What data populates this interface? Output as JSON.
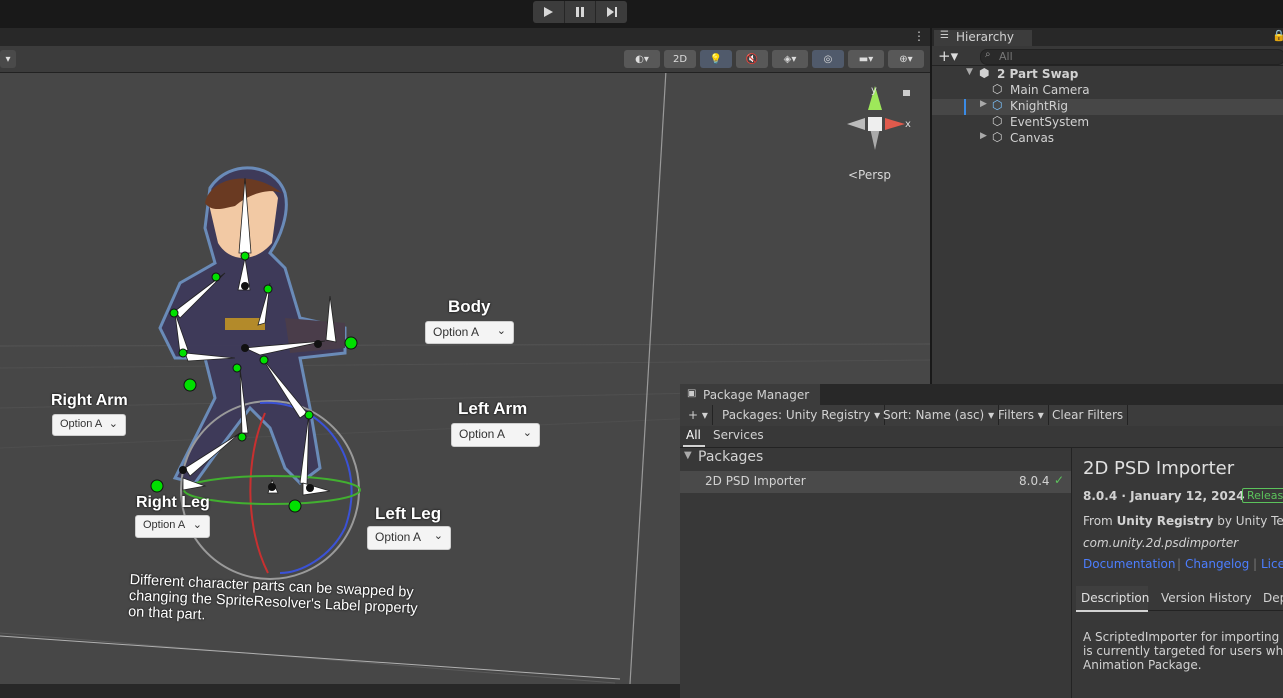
{
  "toolbar": {
    "play_icon": "play-icon",
    "pause_icon": "pause-icon",
    "step_icon": "step-icon"
  },
  "scene": {
    "toolbar_2d_label": "2D",
    "persp_label": "<Persp",
    "gizmo_y": "y",
    "gizmo_x": "x",
    "labels": {
      "body": "Body",
      "right_arm": "Right Arm",
      "left_arm": "Left Arm",
      "right_leg": "Right Leg",
      "left_leg": "Left Leg"
    },
    "dropdowns": {
      "body": "Option A",
      "right_arm": "Option A",
      "left_arm": "Option A",
      "right_leg": "Option A",
      "left_leg": "Option A"
    },
    "note_line1": "Different character parts can be swapped by",
    "note_line2": "changing the SpriteResolver's Label property",
    "note_line3": "on that part."
  },
  "hierarchy": {
    "title": "Hierarchy",
    "search_placeholder": "All",
    "scene_name": "2 Part Swap",
    "items": [
      {
        "label": "Main Camera"
      },
      {
        "label": "KnightRig"
      },
      {
        "label": "EventSystem"
      },
      {
        "label": "Canvas"
      }
    ]
  },
  "package_manager": {
    "title": "Package Manager",
    "packages_dropdown": "Packages: Unity Registry",
    "sort_dropdown": "Sort: Name (asc)",
    "filters_dropdown": "Filters",
    "clear_filters": "Clear Filters",
    "tab_all": "All",
    "tab_services": "Services",
    "group_label": "Packages",
    "list": [
      {
        "name": "2D PSD Importer",
        "version": "8.0.4"
      }
    ],
    "detail": {
      "name": "2D PSD Importer",
      "version_date": "8.0.4 · January 12, 2024",
      "badge": "Release",
      "from_prefix": "From",
      "registry": "Unity Registry",
      "by": "by Unity Techn",
      "package_id": "com.unity.2d.psdimporter",
      "link_docs": "Documentation",
      "link_changelog": "Changelog",
      "link_license": "Lice",
      "tab_description": "Description",
      "tab_version_history": "Version History",
      "tab_dependencies": "Dep",
      "description_line1": "A ScriptedImporter for importing Ac",
      "description_line2": "is currently targeted for users who v",
      "description_line3": "Animation Package."
    }
  },
  "colors": {
    "accent_green": "#00e000",
    "link_blue": "#4c7eff",
    "release_green": "#5cc35c"
  }
}
